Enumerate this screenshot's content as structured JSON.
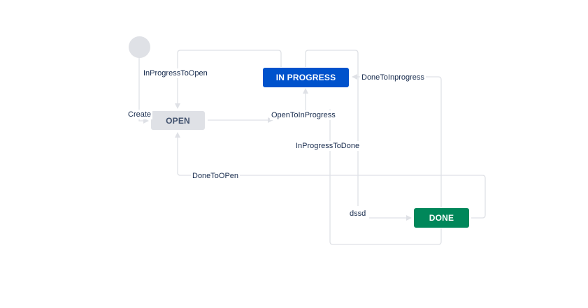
{
  "colors": {
    "line": "#dfe1e6",
    "arrow": "#dfe1e6",
    "label_text": "#172b4d"
  },
  "statuses": {
    "open": {
      "label": "OPEN",
      "bg": "#dfe1e6",
      "fg": "#42526e"
    },
    "in_progress": {
      "label": "IN PROGRESS",
      "bg": "#0052cc",
      "fg": "#ffffff"
    },
    "done": {
      "label": "DONE",
      "bg": "#00875a",
      "fg": "#ffffff"
    }
  },
  "transitions": {
    "create": "Create",
    "in_progress_to_open": "InProgressToOpen",
    "open_to_in_progress": "OpenToInProgress",
    "in_progress_to_done": "InProgressToDone",
    "done_to_in_progress": "DoneToInprogress",
    "done_to_open": "DoneToOPen",
    "dssd": "dssd"
  }
}
